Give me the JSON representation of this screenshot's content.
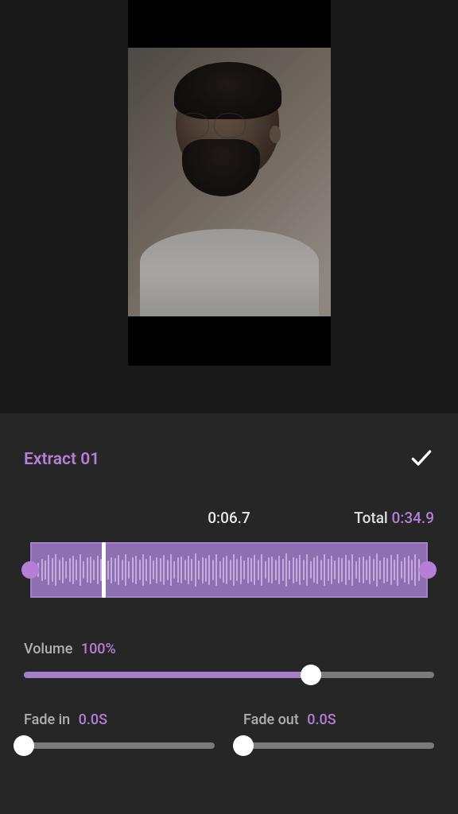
{
  "clip": {
    "title": "Extract 01",
    "current_time": "0:06.7",
    "total_label": "Total",
    "total_time": "0:34.9"
  },
  "volume": {
    "label": "Volume",
    "value": "100%",
    "percent": 70
  },
  "fade_in": {
    "label": "Fade in",
    "value": "0.0S",
    "percent": 0
  },
  "fade_out": {
    "label": "Fade out",
    "value": "0.0S",
    "percent": 0
  },
  "waveform_playhead_percent": 19,
  "waveform_bars": [
    28,
    42,
    36,
    58,
    44,
    62,
    38,
    50,
    32,
    46,
    54,
    40,
    60,
    34,
    48,
    52,
    38,
    56,
    42,
    64,
    36,
    50,
    44,
    58,
    40,
    62,
    34,
    48,
    54,
    38,
    60,
    42,
    56,
    36,
    50,
    44,
    58,
    40,
    62,
    34,
    48,
    52,
    38,
    56,
    42,
    64,
    36,
    50,
    44,
    58,
    40,
    62,
    34,
    48,
    54,
    38,
    60,
    42,
    56,
    36,
    50,
    44,
    58,
    40,
    62,
    34,
    48,
    52,
    38,
    56,
    42,
    64,
    36,
    50,
    44,
    58,
    40,
    62,
    34,
    48,
    54,
    38,
    60,
    42,
    56,
    36,
    50,
    44,
    58,
    40,
    62,
    34,
    48,
    52,
    38,
    56,
    42,
    64,
    36,
    50,
    44,
    58,
    40,
    62,
    34,
    48,
    54,
    38,
    60,
    42
  ]
}
